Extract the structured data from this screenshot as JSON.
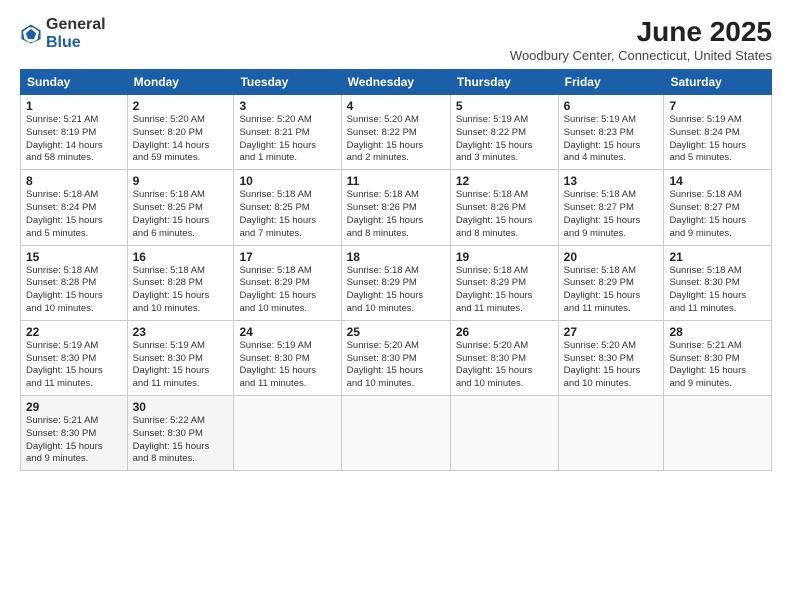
{
  "logo": {
    "general": "General",
    "blue": "Blue"
  },
  "title": "June 2025",
  "location": "Woodbury Center, Connecticut, United States",
  "days_of_week": [
    "Sunday",
    "Monday",
    "Tuesday",
    "Wednesday",
    "Thursday",
    "Friday",
    "Saturday"
  ],
  "weeks": [
    [
      {
        "num": "1",
        "info": "Sunrise: 5:21 AM\nSunset: 8:19 PM\nDaylight: 14 hours\nand 58 minutes."
      },
      {
        "num": "2",
        "info": "Sunrise: 5:20 AM\nSunset: 8:20 PM\nDaylight: 14 hours\nand 59 minutes."
      },
      {
        "num": "3",
        "info": "Sunrise: 5:20 AM\nSunset: 8:21 PM\nDaylight: 15 hours\nand 1 minute."
      },
      {
        "num": "4",
        "info": "Sunrise: 5:20 AM\nSunset: 8:22 PM\nDaylight: 15 hours\nand 2 minutes."
      },
      {
        "num": "5",
        "info": "Sunrise: 5:19 AM\nSunset: 8:22 PM\nDaylight: 15 hours\nand 3 minutes."
      },
      {
        "num": "6",
        "info": "Sunrise: 5:19 AM\nSunset: 8:23 PM\nDaylight: 15 hours\nand 4 minutes."
      },
      {
        "num": "7",
        "info": "Sunrise: 5:19 AM\nSunset: 8:24 PM\nDaylight: 15 hours\nand 5 minutes."
      }
    ],
    [
      {
        "num": "8",
        "info": "Sunrise: 5:18 AM\nSunset: 8:24 PM\nDaylight: 15 hours\nand 5 minutes."
      },
      {
        "num": "9",
        "info": "Sunrise: 5:18 AM\nSunset: 8:25 PM\nDaylight: 15 hours\nand 6 minutes."
      },
      {
        "num": "10",
        "info": "Sunrise: 5:18 AM\nSunset: 8:25 PM\nDaylight: 15 hours\nand 7 minutes."
      },
      {
        "num": "11",
        "info": "Sunrise: 5:18 AM\nSunset: 8:26 PM\nDaylight: 15 hours\nand 8 minutes."
      },
      {
        "num": "12",
        "info": "Sunrise: 5:18 AM\nSunset: 8:26 PM\nDaylight: 15 hours\nand 8 minutes."
      },
      {
        "num": "13",
        "info": "Sunrise: 5:18 AM\nSunset: 8:27 PM\nDaylight: 15 hours\nand 9 minutes."
      },
      {
        "num": "14",
        "info": "Sunrise: 5:18 AM\nSunset: 8:27 PM\nDaylight: 15 hours\nand 9 minutes."
      }
    ],
    [
      {
        "num": "15",
        "info": "Sunrise: 5:18 AM\nSunset: 8:28 PM\nDaylight: 15 hours\nand 10 minutes."
      },
      {
        "num": "16",
        "info": "Sunrise: 5:18 AM\nSunset: 8:28 PM\nDaylight: 15 hours\nand 10 minutes."
      },
      {
        "num": "17",
        "info": "Sunrise: 5:18 AM\nSunset: 8:29 PM\nDaylight: 15 hours\nand 10 minutes."
      },
      {
        "num": "18",
        "info": "Sunrise: 5:18 AM\nSunset: 8:29 PM\nDaylight: 15 hours\nand 10 minutes."
      },
      {
        "num": "19",
        "info": "Sunrise: 5:18 AM\nSunset: 8:29 PM\nDaylight: 15 hours\nand 11 minutes."
      },
      {
        "num": "20",
        "info": "Sunrise: 5:18 AM\nSunset: 8:29 PM\nDaylight: 15 hours\nand 11 minutes."
      },
      {
        "num": "21",
        "info": "Sunrise: 5:18 AM\nSunset: 8:30 PM\nDaylight: 15 hours\nand 11 minutes."
      }
    ],
    [
      {
        "num": "22",
        "info": "Sunrise: 5:19 AM\nSunset: 8:30 PM\nDaylight: 15 hours\nand 11 minutes."
      },
      {
        "num": "23",
        "info": "Sunrise: 5:19 AM\nSunset: 8:30 PM\nDaylight: 15 hours\nand 11 minutes."
      },
      {
        "num": "24",
        "info": "Sunrise: 5:19 AM\nSunset: 8:30 PM\nDaylight: 15 hours\nand 11 minutes."
      },
      {
        "num": "25",
        "info": "Sunrise: 5:20 AM\nSunset: 8:30 PM\nDaylight: 15 hours\nand 10 minutes."
      },
      {
        "num": "26",
        "info": "Sunrise: 5:20 AM\nSunset: 8:30 PM\nDaylight: 15 hours\nand 10 minutes."
      },
      {
        "num": "27",
        "info": "Sunrise: 5:20 AM\nSunset: 8:30 PM\nDaylight: 15 hours\nand 10 minutes."
      },
      {
        "num": "28",
        "info": "Sunrise: 5:21 AM\nSunset: 8:30 PM\nDaylight: 15 hours\nand 9 minutes."
      }
    ],
    [
      {
        "num": "29",
        "info": "Sunrise: 5:21 AM\nSunset: 8:30 PM\nDaylight: 15 hours\nand 9 minutes."
      },
      {
        "num": "30",
        "info": "Sunrise: 5:22 AM\nSunset: 8:30 PM\nDaylight: 15 hours\nand 8 minutes."
      },
      {
        "num": "",
        "info": ""
      },
      {
        "num": "",
        "info": ""
      },
      {
        "num": "",
        "info": ""
      },
      {
        "num": "",
        "info": ""
      },
      {
        "num": "",
        "info": ""
      }
    ]
  ]
}
